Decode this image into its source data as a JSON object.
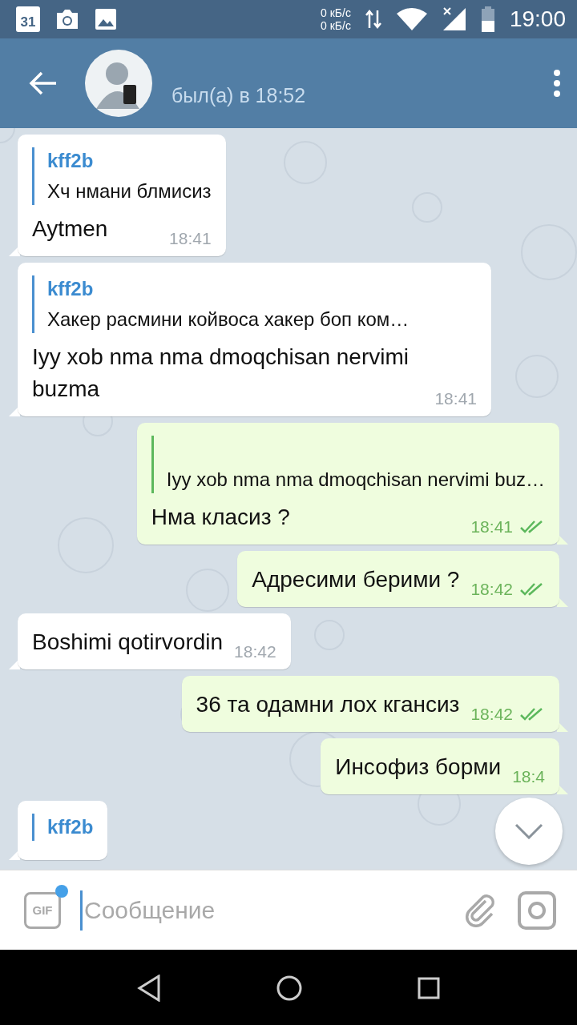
{
  "status_bar": {
    "calendar_day": "31",
    "net_up": "0 кБ/с",
    "net_down": "0 кБ/с",
    "time": "19:00"
  },
  "header": {
    "last_seen": "был(а) в 18:52"
  },
  "messages": [
    {
      "kind": "incoming",
      "reply": {
        "name": "kff2b",
        "text": "Хч нмани блмисиз"
      },
      "text": "Aytmen",
      "time": "18:41"
    },
    {
      "kind": "incoming",
      "reply": {
        "name": "kff2b",
        "text": "Хакер расмини койвоса хакер боп ком…"
      },
      "text": "Iyy xob nma nma dmoqchisan nervimi buzma",
      "time": "18:41"
    },
    {
      "kind": "outgoing",
      "reply": {
        "text": "Iyy xob nma nma dmoqchisan nervimi buz…"
      },
      "text": "Нма класиз ?",
      "time": "18:41",
      "read": true
    },
    {
      "kind": "outgoing",
      "text": "Адресими берими ?",
      "time": "18:42",
      "read": true
    },
    {
      "kind": "incoming",
      "text": "Boshimi qotirvordin",
      "time": "18:42"
    },
    {
      "kind": "outgoing",
      "text": "36 та одамни лох кгансиз",
      "time": "18:42",
      "read": true
    },
    {
      "kind": "outgoing",
      "text": "Инсофиз борми",
      "time": "18:4"
    },
    {
      "kind": "incoming",
      "reply": {
        "name": "kff2b"
      }
    }
  ],
  "composer": {
    "gif_label": "GIF",
    "gif_badge": true,
    "placeholder": "Сообщение"
  }
}
